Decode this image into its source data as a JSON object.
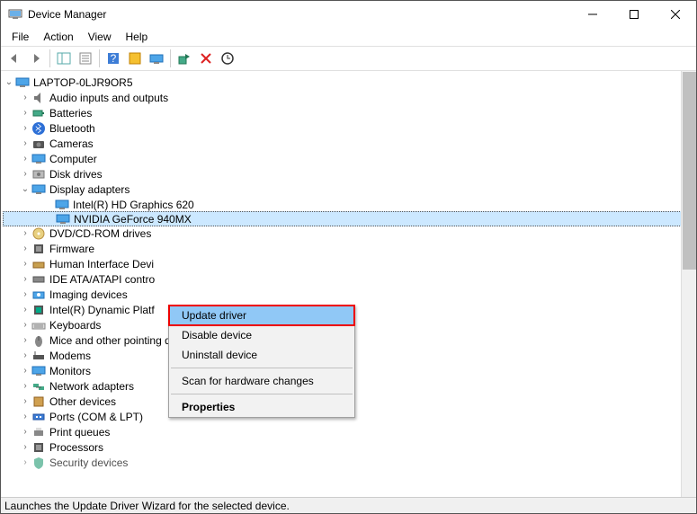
{
  "window": {
    "title": "Device Manager",
    "minimize_icon": "minimize",
    "maximize_icon": "maximize",
    "close_icon": "close"
  },
  "menu": {
    "items": [
      "File",
      "Action",
      "View",
      "Help"
    ]
  },
  "tree": {
    "root": "LAPTOP-0LJR9OR5",
    "nodes": [
      {
        "label": "Audio inputs and outputs",
        "expanded": false
      },
      {
        "label": "Batteries",
        "expanded": false
      },
      {
        "label": "Bluetooth",
        "expanded": false
      },
      {
        "label": "Cameras",
        "expanded": false
      },
      {
        "label": "Computer",
        "expanded": false
      },
      {
        "label": "Disk drives",
        "expanded": false
      },
      {
        "label": "Display adapters",
        "expanded": true,
        "children": [
          {
            "label": "Intel(R) HD Graphics 620"
          },
          {
            "label": "NVIDIA GeForce 940MX",
            "selected": true
          }
        ]
      },
      {
        "label": "DVD/CD-ROM drives",
        "expanded": false
      },
      {
        "label": "Firmware",
        "expanded": false
      },
      {
        "label": "Human Interface Devi",
        "expanded": false,
        "truncated": true
      },
      {
        "label": "IDE ATA/ATAPI contro",
        "expanded": false,
        "truncated": true
      },
      {
        "label": "Imaging devices",
        "expanded": false
      },
      {
        "label": "Intel(R) Dynamic Platf",
        "expanded": false,
        "truncated": true
      },
      {
        "label": "Keyboards",
        "expanded": false
      },
      {
        "label": "Mice and other pointing devices",
        "expanded": false
      },
      {
        "label": "Modems",
        "expanded": false
      },
      {
        "label": "Monitors",
        "expanded": false
      },
      {
        "label": "Network adapters",
        "expanded": false
      },
      {
        "label": "Other devices",
        "expanded": false
      },
      {
        "label": "Ports (COM & LPT)",
        "expanded": false
      },
      {
        "label": "Print queues",
        "expanded": false
      },
      {
        "label": "Processors",
        "expanded": false
      },
      {
        "label": "Security devices",
        "expanded": false,
        "cutoff": true
      }
    ]
  },
  "context_menu": {
    "items": [
      "Update driver",
      "Disable device",
      "Uninstall device",
      "Scan for hardware changes",
      "Properties"
    ],
    "highlighted_index": 0
  },
  "statusbar": {
    "text": "Launches the Update Driver Wizard for the selected device."
  }
}
